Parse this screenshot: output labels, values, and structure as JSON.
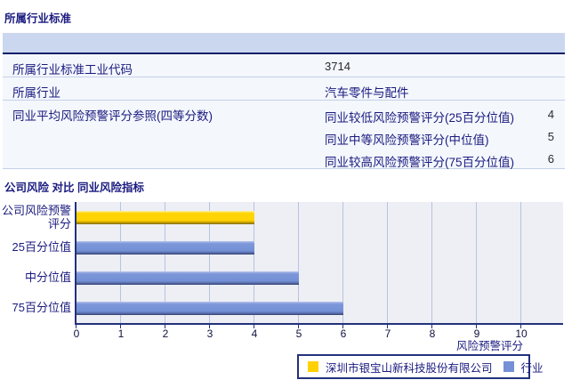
{
  "colors": {
    "accent_navy": "#1b1b80",
    "table_band": "#cbd7ee",
    "band_underline": "#0b1e6b",
    "row_separator": "#c5d0e8",
    "plot_background": "#edeff5",
    "gridline": "#b8c3e0",
    "axis": "#23317c",
    "company_bar": "#FFD103",
    "industry_bar": "#7590D6"
  },
  "section1": {
    "title": "所属行业标准",
    "rows": [
      {
        "label": "所属行业标准工业代码",
        "value": "3714"
      },
      {
        "label": "所属行业",
        "value": "汽车零件与配件"
      },
      {
        "label": "同业平均风险预警评分参照(四等分数)",
        "subrows": [
          {
            "label": "同业较低风险预警评分(25百分位值)",
            "value": "4"
          },
          {
            "label": "同业中等风险预警评分(中位值)",
            "value": "5"
          },
          {
            "label": "同业较高风险预警评分(75百分位值)",
            "value": "6"
          }
        ]
      }
    ]
  },
  "section2": {
    "title": "公司风险 对比 同业风险指标"
  },
  "chart_data": {
    "type": "bar",
    "orientation": "horizontal",
    "title": "公司风险 对比 同业风险指标",
    "categories": [
      "公司风险预警评分",
      "25百分位值",
      "中分位值",
      "75百分位值"
    ],
    "values": [
      4,
      4,
      5,
      6
    ],
    "series_of_bar": [
      "company",
      "industry",
      "industry",
      "industry"
    ],
    "xlabel": "风险预警评分",
    "xlim": [
      0,
      10
    ],
    "xticks": [
      0,
      1,
      2,
      3,
      4,
      5,
      6,
      7,
      8,
      9,
      10
    ],
    "grid": true,
    "legend_position": "bottom-right",
    "legend": [
      {
        "series": "company",
        "label": "深圳市银宝山新科技股份有限公司",
        "color": "#FFD103"
      },
      {
        "series": "industry",
        "label": "行业",
        "color": "#7590D6"
      }
    ]
  }
}
